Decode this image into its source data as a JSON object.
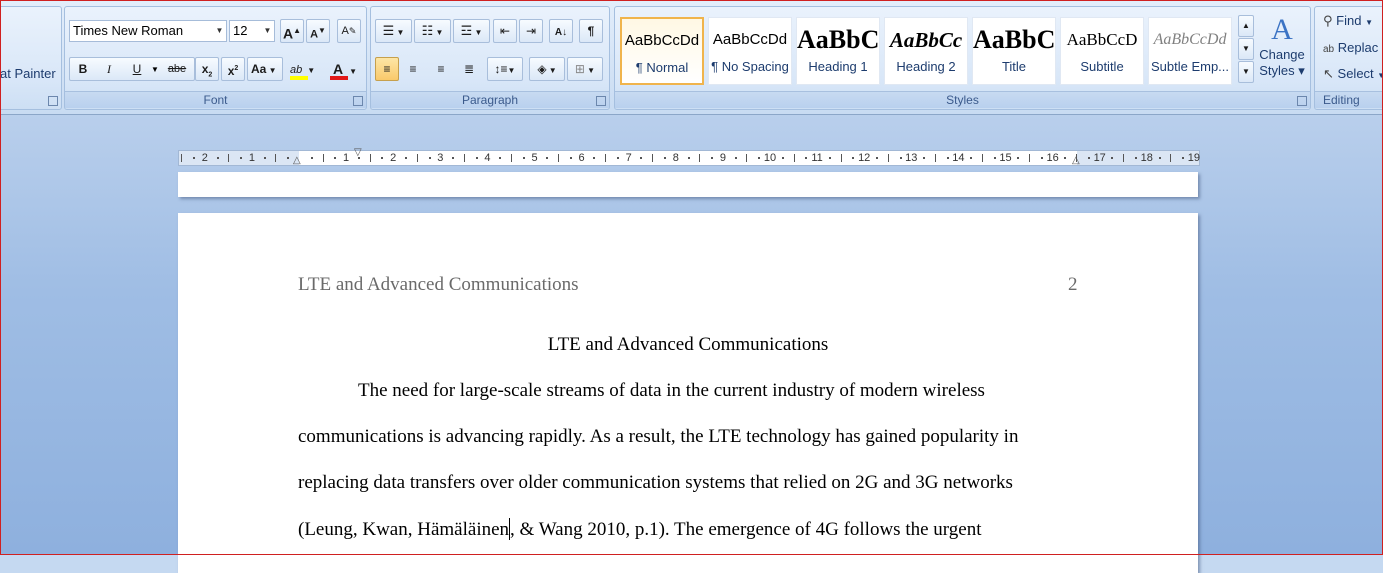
{
  "clipboard": {
    "format_painter_label": "at Painter"
  },
  "font": {
    "group_label": "Font",
    "font_name": "Times New Roman",
    "font_size": "12",
    "grow_label": "A",
    "shrink_label": "A",
    "clear_label": "A",
    "bold_label": "B",
    "italic_label": "I",
    "underline_label": "U",
    "strike_label": "abe",
    "subscript_label": "x",
    "superscript_label": "x",
    "change_case_label": "Aa",
    "highlight_label": "ab",
    "font_color_label": "A",
    "highlight_color": "#ffff00",
    "font_color": "#e11818"
  },
  "paragraph": {
    "group_label": "Paragraph"
  },
  "styles": {
    "group_label": "Styles",
    "items": [
      {
        "sample": "AaBbCcDd",
        "name": "¶ Normal"
      },
      {
        "sample": "AaBbCcDd",
        "name": "¶ No Spacing"
      },
      {
        "sample": "AaBbC",
        "name": "Heading 1"
      },
      {
        "sample": "AaBbCc",
        "name": "Heading 2"
      },
      {
        "sample": "AaBbC",
        "name": "Title"
      },
      {
        "sample": "AaBbCcD",
        "name": "Subtitle"
      },
      {
        "sample": "AaBbCcDd",
        "name": "Subtle Emp..."
      }
    ],
    "change_styles_line1": "Change",
    "change_styles_line2": "Styles"
  },
  "editing": {
    "group_label": "Editing",
    "find_label": "Find",
    "replace_label": "Replac",
    "select_label": "Select"
  },
  "ruler": {
    "left_labels": [
      "2",
      "1"
    ],
    "right_labels": [
      "1",
      "2",
      "3",
      "4",
      "5",
      "6",
      "7",
      "8",
      "9",
      "10",
      "11",
      "12",
      "13",
      "14",
      "15",
      "16",
      "17",
      "18",
      "19"
    ]
  },
  "document": {
    "header_title": "LTE and Advanced Communications",
    "header_page": "2",
    "title": "LTE and Advanced Communications",
    "lines": [
      "The need for large-scale streams of data in the current industry of modern wireless",
      "communications is advancing rapidly. As a result, the LTE technology has gained popularity in",
      "replacing data transfers over older communication systems that relied on 2G and 3G networks"
    ],
    "line4_before_caret": "(Leung, Kwan, Hämäläinen",
    "line4_after_caret": ", & Wang 2010, p.1). The emergence of 4G follows the urgent"
  }
}
